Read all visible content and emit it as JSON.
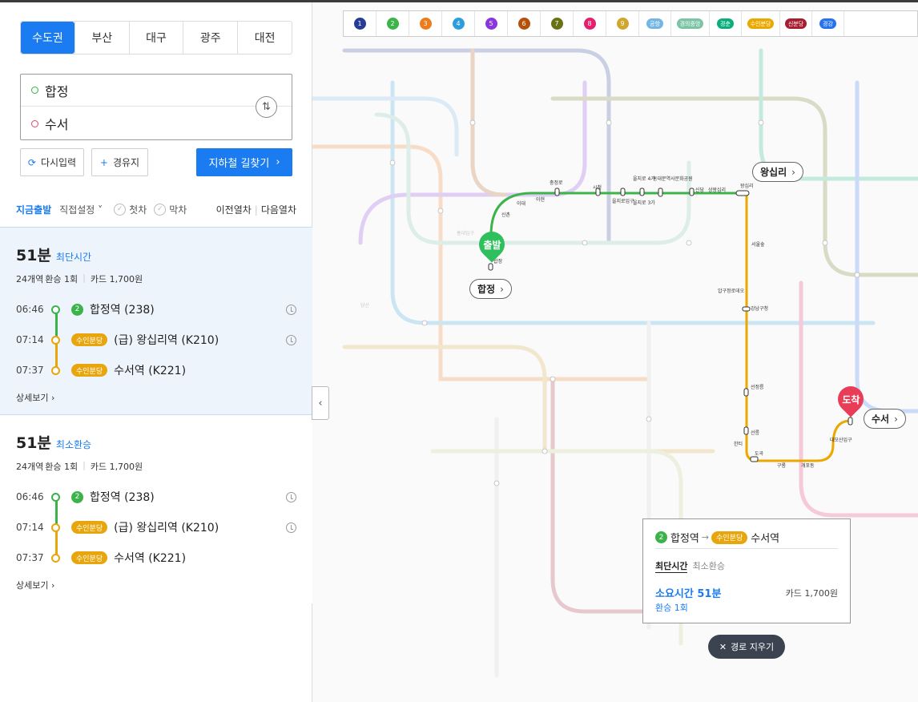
{
  "regions": [
    "수도권",
    "부산",
    "대구",
    "광주",
    "대전"
  ],
  "active_region": "수도권",
  "search": {
    "from": "합정",
    "to": "수서"
  },
  "buttons": {
    "reset": "다시입력",
    "via": "경유지",
    "find": "지하철 길찾기"
  },
  "options": {
    "now": "지금출발",
    "direct": "직접설정",
    "first": "첫차",
    "last": "막차",
    "prev": "이전열차",
    "next": "다음열차"
  },
  "routes": [
    {
      "minutes": "51분",
      "type": "최단시간",
      "stations": "24개역",
      "transfers": "환승 1회",
      "fare": "카드 1,700원",
      "stops": [
        {
          "time": "06:46",
          "badge": "2",
          "badge_kind": "num",
          "name": "합정역 (238)"
        },
        {
          "time": "07:14",
          "badge": "수인분당",
          "badge_kind": "line",
          "name": "(급) 왕십리역 (K210)"
        },
        {
          "time": "07:37",
          "badge": "수인분당",
          "badge_kind": "line",
          "name": "수서역 (K221)"
        }
      ],
      "detail": "상세보기"
    },
    {
      "minutes": "51분",
      "type": "최소환승",
      "stations": "24개역",
      "transfers": "환승 1회",
      "fare": "카드 1,700원",
      "stops": [
        {
          "time": "06:46",
          "badge": "2",
          "badge_kind": "num",
          "name": "합정역 (238)"
        },
        {
          "time": "07:14",
          "badge": "수인분당",
          "badge_kind": "line",
          "name": "(급) 왕십리역 (K210)"
        },
        {
          "time": "07:37",
          "badge": "수인분당",
          "badge_kind": "line",
          "name": "수서역 (K221)"
        }
      ],
      "detail": "상세보기"
    }
  ],
  "line_bar": [
    {
      "label": "1",
      "color": "#263c96"
    },
    {
      "label": "2",
      "color": "#3cb44a"
    },
    {
      "label": "3",
      "color": "#ef7c1c"
    },
    {
      "label": "4",
      "color": "#2c9ede"
    },
    {
      "label": "5",
      "color": "#8936e0"
    },
    {
      "label": "6",
      "color": "#b5500b"
    },
    {
      "label": "7",
      "color": "#697215"
    },
    {
      "label": "8",
      "color": "#e51e6e"
    },
    {
      "label": "9",
      "color": "#d1a62c"
    },
    {
      "label": "공항",
      "color": "#73b6e4"
    },
    {
      "label": "경의중앙",
      "color": "#7cc4a5"
    },
    {
      "label": "경춘",
      "color": "#08af7b"
    },
    {
      "label": "수인분당",
      "color": "#eba900"
    },
    {
      "label": "신분당",
      "color": "#a71e31"
    },
    {
      "label": "경강",
      "color": "#2673f2"
    }
  ],
  "map": {
    "start_pin": "출발",
    "end_pin": "도착",
    "chip_start": "합정",
    "chip_transfer": "왕십리",
    "chip_end": "수서",
    "labels": [
      "신촌",
      "이대",
      "아현",
      "충정로",
      "시청",
      "을지로입구",
      "을지로 3가",
      "을지로 4가",
      "동대문역사문화공원",
      "신당",
      "상왕십리",
      "왕십리",
      "서울숲",
      "압구정로데오",
      "강남구청",
      "선정릉",
      "선릉",
      "한티",
      "도곡",
      "구룡",
      "개포동",
      "대모산입구",
      "합정",
      "당산",
      "홍대입구"
    ]
  },
  "popup": {
    "from_badge": "2",
    "from": "합정역",
    "line": "수인분당",
    "to": "수서역",
    "tab_on": "최단시간",
    "tab_off": "최소환승",
    "duration": "소요시간 51분",
    "fare": "카드 1,700원",
    "transfer": "환승 1회"
  },
  "clear_route": "경로 지우기",
  "colors": {
    "accent": "#1a7cf0",
    "line2": "#3cb44a",
    "suin_bundang": "#eba900"
  }
}
